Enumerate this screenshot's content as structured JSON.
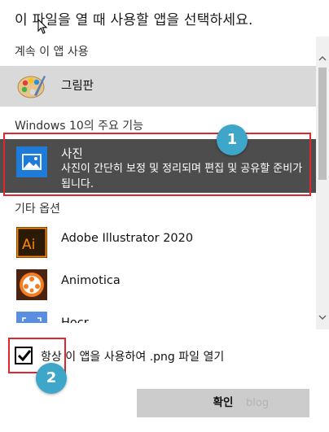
{
  "dialog": {
    "title": "이 파일을 열 때 사용할 앱을 선택하세요."
  },
  "sections": {
    "continue_label": "계속 이 앱 사용",
    "windows_label": "Windows 10의 주요 기능",
    "other_label": "기타 옵션"
  },
  "apps": {
    "paint": {
      "name": "그림판",
      "icon": "paint-palette-icon"
    },
    "photos": {
      "name": "사진",
      "description": "사진이 간단히 보정 및 정리되며 편집 및 공유할 준비가 됩니다.",
      "icon": "photos-icon"
    },
    "illustrator": {
      "name": "Adobe Illustrator 2020",
      "icon": "illustrator-icon"
    },
    "animotica": {
      "name": "Animotica",
      "icon": "animotica-icon"
    },
    "hocr": {
      "name": "Hocr",
      "icon": "hocr-icon"
    }
  },
  "checkbox": {
    "label": "항상 이 앱을 사용하여 .png 파일 열기",
    "checked": true
  },
  "buttons": {
    "ok_label": "확인"
  },
  "annotations": {
    "badge1": "1",
    "badge2": "2"
  },
  "watermark": "blog",
  "colors": {
    "selected_bg": "#4d4d4d",
    "hover_bg": "#d9d9d9",
    "annotation_red": "#e0262e",
    "badge_blue": "#3ea6c9",
    "button_bg": "#cccccc"
  }
}
